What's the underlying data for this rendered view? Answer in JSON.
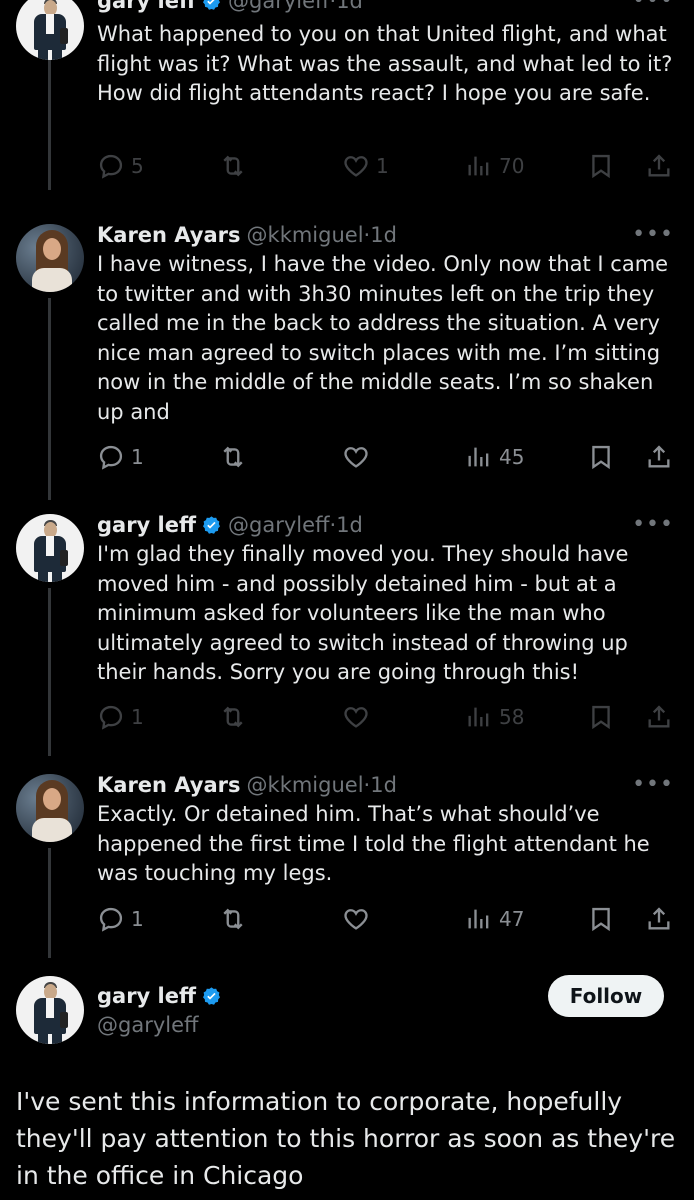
{
  "tweets": [
    {
      "name": "gary leff",
      "verified": true,
      "handle": "@garyleff",
      "time": "1d",
      "text": "What happened to you on that United flight, and what flight was it? What was the assault, and what led to it?  How did flight attendants react?  I hope you are safe.",
      "replies": "5",
      "retweets": "",
      "likes": "1",
      "views": "70",
      "dimmed": true
    },
    {
      "name": "Karen Ayars",
      "verified": false,
      "handle": "@kkmiguel",
      "time": "1d",
      "text": "I have witness, I have the video. Only now that I came to twitter and with 3h30 minutes left on the trip they called me in the back to address the situation. A very nice man agreed to switch places with me. I’m sitting now in the middle of the middle seats. I’m so shaken up and",
      "replies": "1",
      "retweets": "",
      "likes": "",
      "views": "45",
      "dimmed": false
    },
    {
      "name": "gary leff",
      "verified": true,
      "handle": "@garyleff",
      "time": "1d",
      "text": "I'm glad they finally moved you. They should have moved him - and possibly detained him - but at a minimum asked for volunteers like the man who ultimately agreed to switch instead of throwing up their hands. Sorry you are going through this!",
      "replies": "1",
      "retweets": "",
      "likes": "",
      "views": "58",
      "dimmed": true
    },
    {
      "name": "Karen Ayars",
      "verified": false,
      "handle": "@kkmiguel",
      "time": "1d",
      "text": "Exactly. Or detained him. That’s what should’ve happened the first time I told the flight attendant he was touching my legs.",
      "replies": "1",
      "retweets": "",
      "likes": "",
      "views": "47",
      "dimmed": false
    }
  ],
  "main_tweet": {
    "name": "gary leff",
    "verified": true,
    "handle": "@garyleff",
    "follow_label": "Follow",
    "text": "I've sent this information to corporate, hopefully they'll pay attention to this horror as soon as they're in the office in Chicago"
  },
  "separator": " · ",
  "more_glyph": "•••",
  "colors": {
    "background": "#000000",
    "text": "#e7e9ea",
    "muted": "#71767b",
    "verified": "#1d9bf0",
    "thread_line": "#333639",
    "follow_bg": "#eff3f4"
  },
  "icons": [
    "reply-icon",
    "retweet-icon",
    "like-icon",
    "views-icon",
    "bookmark-icon",
    "share-icon",
    "verified-badge-icon",
    "more-icon"
  ]
}
